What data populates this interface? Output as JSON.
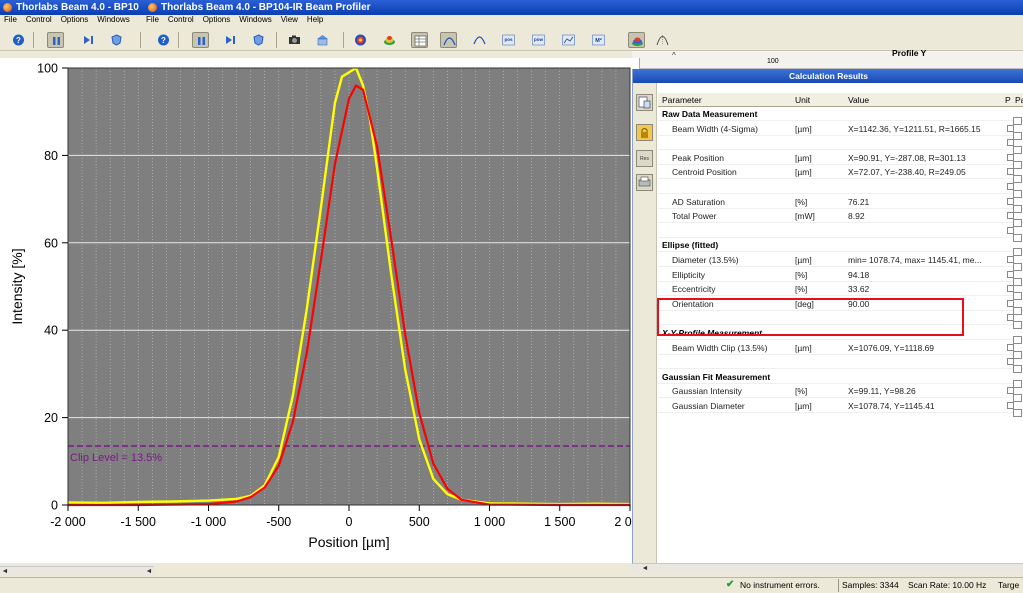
{
  "window": {
    "title_left": "Thorlabs Beam 4.0 - BP10",
    "title_right": "Thorlabs Beam 4.0 - BP104-IR Beam Profiler"
  },
  "menus": {
    "left": [
      "File",
      "Control",
      "Options",
      "Windows"
    ],
    "right": [
      "File",
      "Control",
      "Options",
      "Windows",
      "View",
      "Help"
    ]
  },
  "toolbar_icons": [
    "help-icon",
    "pause-icon",
    "play-next-icon",
    "shield-icon",
    "help-icon",
    "pause-icon",
    "play-next-icon",
    "shield-icon",
    "camera-icon",
    "building-icon",
    "beam-2d-icon",
    "beam-3d-icon",
    "table-icon",
    "profile-x-icon",
    "profile-y-icon",
    "pos-icon",
    "pow-icon",
    "chart-icon",
    "m2-icon",
    "beam-color-icon",
    "gaussian-icon"
  ],
  "behind_panel": {
    "profile_y_label": "Profile Y",
    "scale_value": "100"
  },
  "chart_data": {
    "type": "line",
    "xlabel": "Position [µm]",
    "ylabel": "Intensity [%]",
    "xlim": [
      -2000,
      2000
    ],
    "ylim": [
      0,
      100
    ],
    "x_ticks": [
      -2000,
      -1500,
      -1000,
      -500,
      0,
      500,
      1000,
      1500,
      2000
    ],
    "x_tick_labels": [
      "-2 000",
      "-1 500",
      "-1 000",
      "-500",
      "0",
      "500",
      "1 000",
      "1 500",
      "2 000"
    ],
    "y_ticks": [
      0,
      20,
      40,
      60,
      80,
      100
    ],
    "y_tick_labels": [
      "0",
      "20",
      "40",
      "60",
      "80",
      "100"
    ],
    "series": [
      {
        "color": "#ffff00",
        "x": [
          -2000,
          -1750,
          -1500,
          -1250,
          -1000,
          -800,
          -700,
          -600,
          -500,
          -400,
          -300,
          -200,
          -150,
          -100,
          -50,
          0,
          50,
          100,
          150,
          200,
          300,
          400,
          500,
          600,
          700,
          800,
          1000,
          1250,
          1500,
          1750,
          2000
        ],
        "y": [
          0.6,
          0.5,
          0.7,
          0.8,
          1.0,
          1.4,
          2.1,
          4.5,
          11,
          25,
          45,
          68,
          80,
          92,
          98,
          99,
          100,
          96,
          88,
          77,
          53,
          31,
          15,
          6,
          2.5,
          1.2,
          0.4,
          0.3,
          0.2,
          0.3,
          0.2
        ]
      },
      {
        "color": "#ff0000",
        "x": [
          -2000,
          -1500,
          -1000,
          -800,
          -700,
          -600,
          -500,
          -400,
          -300,
          -200,
          -100,
          0,
          50,
          100,
          200,
          300,
          400,
          500,
          600,
          700,
          800,
          1000,
          1500,
          2000
        ],
        "y": [
          0,
          0,
          0.2,
          0.8,
          1.8,
          4,
          9,
          19,
          35,
          56,
          78,
          93,
          96,
          95,
          82,
          61,
          39,
          21,
          9.5,
          3.7,
          1.2,
          0.1,
          0,
          0
        ]
      }
    ],
    "clip_level": {
      "y": 13.5,
      "label": "Clip Level = 13.5%",
      "color": "#7a1a86"
    },
    "grid": true,
    "background": "#7f7f7f"
  },
  "results_panel": {
    "title": "Calculation Results",
    "columns": [
      "Parameter",
      "Unit",
      "Value",
      "P",
      "Pa"
    ],
    "rows": [
      {
        "type": "section",
        "param": "Raw Data Measurement"
      },
      {
        "type": "data",
        "param": "Beam Width (4-Sigma)",
        "unit": "[µm]",
        "value": "X=1142.36, Y=1211.51, R=1665.15"
      },
      {
        "type": "empty"
      },
      {
        "type": "data",
        "param": "Peak Position",
        "unit": "[µm]",
        "value": "X=90.91, Y=-287.08, R=301.13"
      },
      {
        "type": "data",
        "param": "Centroid Position",
        "unit": "[µm]",
        "value": "X=72.07, Y=-238.40, R=249.05"
      },
      {
        "type": "empty"
      },
      {
        "type": "data",
        "param": "AD Saturation",
        "unit": "[%]",
        "value": "76.21"
      },
      {
        "type": "data",
        "param": "Total Power",
        "unit": "[mW]",
        "value": "8.92"
      },
      {
        "type": "empty"
      },
      {
        "type": "section",
        "param": "Ellipse (fitted)"
      },
      {
        "type": "data",
        "param": "Diameter (13.5%)",
        "unit": "[µm]",
        "value": "min= 1078.74, max= 1145.41, me..."
      },
      {
        "type": "data",
        "param": "Ellipticity",
        "unit": "[%]",
        "value": "94.18"
      },
      {
        "type": "data",
        "param": "Eccentricity",
        "unit": "[%]",
        "value": "33.62"
      },
      {
        "type": "data",
        "param": "Orientation",
        "unit": "[deg]",
        "value": "90.00"
      },
      {
        "type": "empty"
      },
      {
        "type": "section",
        "italic": true,
        "param": "X-Y-Profile Measurement"
      },
      {
        "type": "data",
        "param": "Beam Width Clip (13.5%)",
        "unit": "[µm]",
        "value": "X=1076.09, Y=1118.69"
      },
      {
        "type": "empty"
      },
      {
        "type": "section",
        "param": "Gaussian Fit Measurement"
      },
      {
        "type": "data",
        "param": "Gaussian Intensity",
        "unit": "[%]",
        "value": "X=99.11, Y=98.26"
      },
      {
        "type": "data",
        "param": "Gaussian Diameter",
        "unit": "[µm]",
        "value": "X=1078.74, Y=1145.41"
      }
    ]
  },
  "status": {
    "instrument": "No instrument errors.",
    "samples": "Samples: 3344",
    "scan_rate": "Scan Rate: 10.00 Hz",
    "target": "Targe"
  }
}
